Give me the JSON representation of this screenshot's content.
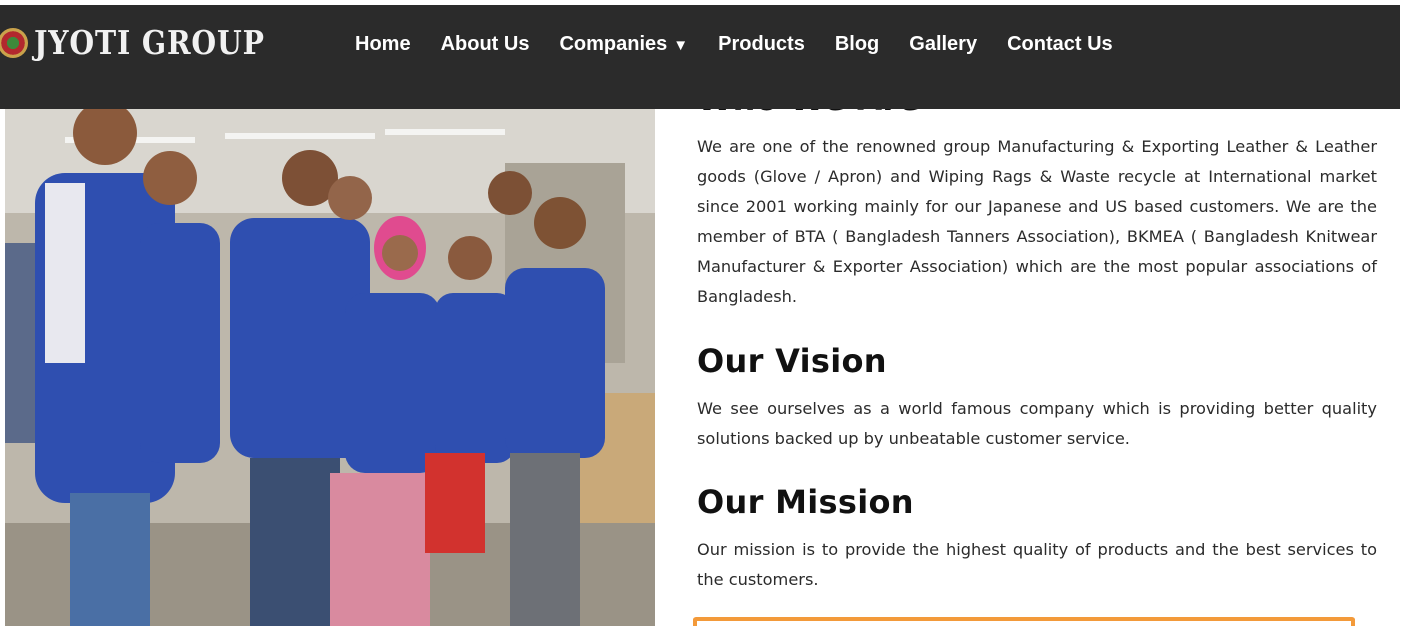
{
  "brand": {
    "name": "JYOTI GROUP"
  },
  "nav": {
    "items": [
      {
        "label": "Home"
      },
      {
        "label": "About Us"
      },
      {
        "label": "Companies",
        "has_dropdown": true
      },
      {
        "label": "Products"
      },
      {
        "label": "Blog"
      },
      {
        "label": "Gallery"
      },
      {
        "label": "Contact Us"
      }
    ]
  },
  "sections": {
    "who": {
      "title": "Who We Are",
      "body": "We are one of the renowned group Manufacturing & Exporting Leather & Leather goods (Glove / Apron) and Wiping Rags & Waste recycle at International market since 2001 working mainly for our Japanese and US based customers. We are the member of BTA ( Bangladesh Tanners Association), BKMEA ( Bangladesh Knitwear Manufacturer & Exporter Association) which are the most popular associations of Bangladesh."
    },
    "vision": {
      "title": "Our Vision",
      "body": "We see ourselves as a world famous company which is providing better quality solutions backed up by unbeatable customer service."
    },
    "mission": {
      "title": "Our Mission",
      "body": "Our mission is to provide the highest quality of products and the best services to the customers."
    }
  },
  "colors": {
    "navbar": "#2b2b2b",
    "accent_orange": "#f39a3a",
    "vest_blue": "#2f4fb0"
  },
  "icons": {
    "dropdown": "caret-down-icon",
    "logo": "logo-emblem-icon"
  }
}
